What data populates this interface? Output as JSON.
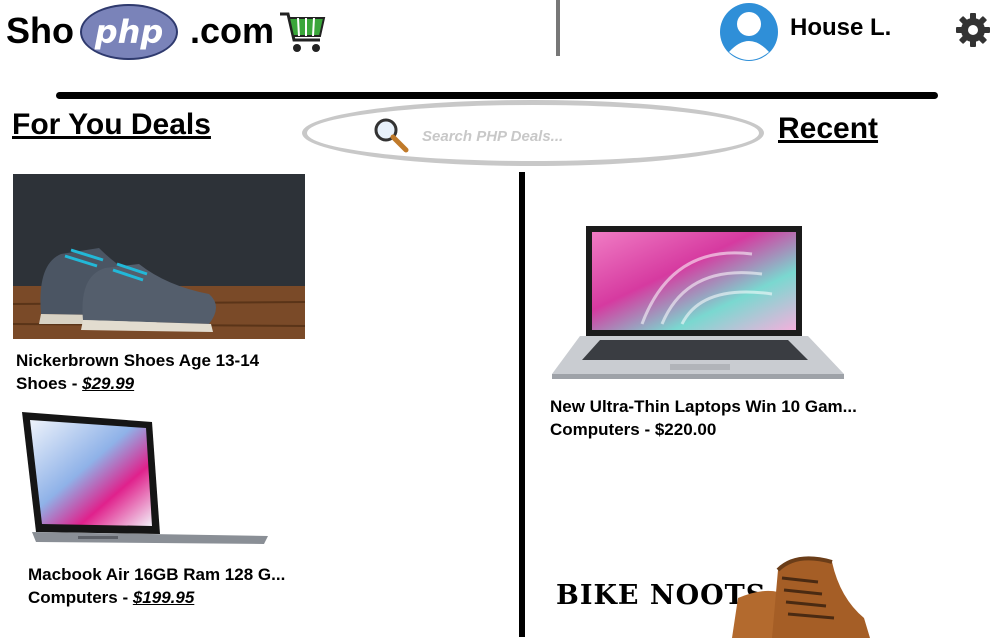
{
  "header": {
    "logo_left": "Sho",
    "logo_badge": "php",
    "logo_right": ".com",
    "username": "House L."
  },
  "sections": {
    "deals_title": "For You Deals",
    "recent_title": "Recent"
  },
  "search": {
    "placeholder": "Search PHP Deals..."
  },
  "deals": [
    {
      "name": "Nickerbrown Shoes Age 13-14",
      "category": "Shoes",
      "separator": " - ",
      "price": "$29.99"
    },
    {
      "name": "Macbook Air 16GB Ram 128 G...",
      "category": "Computers",
      "separator": " - ",
      "price": "$199.95"
    }
  ],
  "recent": [
    {
      "name": "New Ultra-Thin Laptops Win 10 Gam...",
      "category": "Computers",
      "separator": " - ",
      "price": "$220.00"
    }
  ],
  "banner": {
    "text": "BIKE NOOTS"
  },
  "icons": {
    "cart": "shopping-cart-icon",
    "avatar": "user-avatar-icon",
    "settings": "gear-icon",
    "search": "magnifier-icon"
  },
  "colors": {
    "badge": "#7a83b9",
    "cart": "#3aa63a",
    "avatar": "#2f8fd8",
    "search_border": "#c8c8c8",
    "gear": "#333333"
  }
}
